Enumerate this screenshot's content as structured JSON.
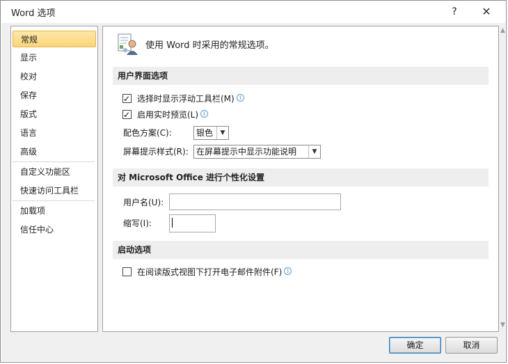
{
  "window": {
    "title": "Word 选项",
    "help": "?",
    "close": "✕"
  },
  "nav": {
    "items": [
      {
        "label": "常规",
        "selected": true
      },
      {
        "label": "显示"
      },
      {
        "label": "校对"
      },
      {
        "label": "保存"
      },
      {
        "label": "版式"
      },
      {
        "label": "语言"
      },
      {
        "label": "高级"
      },
      {
        "label": "自定义功能区"
      },
      {
        "label": "快速访问工具栏"
      },
      {
        "label": "加载项"
      },
      {
        "label": "信任中心"
      }
    ]
  },
  "panel": {
    "header": "使用 Word 时采用的常规选项。",
    "ui_section": {
      "title": "用户界面选项",
      "float_toolbar": {
        "label": "选择时显示浮动工具栏(M)",
        "checked": true
      },
      "live_preview": {
        "label": "启用实时预览(L)",
        "checked": true
      },
      "color_scheme": {
        "label": "配色方案(C):",
        "value": "银色"
      },
      "screentip": {
        "label": "屏幕提示样式(R):",
        "value": "在屏幕提示中显示功能说明"
      }
    },
    "personalize_section": {
      "title": "对 Microsoft Office 进行个性化设置",
      "username": {
        "label": "用户名(U):",
        "value": ""
      },
      "initials": {
        "label": "缩写(I):",
        "value": ""
      }
    },
    "startup_section": {
      "title": "启动选项",
      "open_attachments": {
        "label": "在阅读版式视图下打开电子邮件附件(F)",
        "checked": false
      }
    }
  },
  "buttons": {
    "ok": "确定",
    "cancel": "取消"
  },
  "icons": {
    "info": "i"
  }
}
